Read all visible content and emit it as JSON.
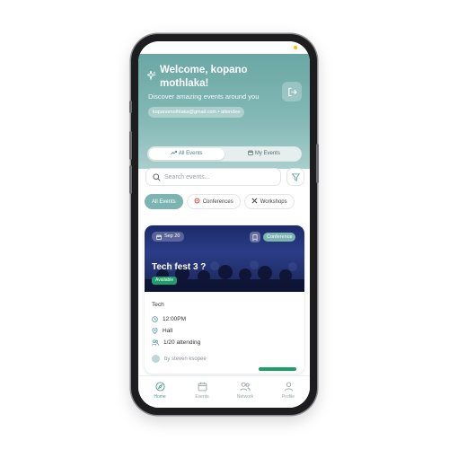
{
  "header": {
    "welcome": "Welcome, kopano mothlaka!",
    "subtitle": "Discover amazing events around you",
    "user_chip": "kopanomothlaka@gmail.com • attendee"
  },
  "tabs": [
    {
      "label": "All Events",
      "active": true
    },
    {
      "label": "My Events",
      "active": false
    }
  ],
  "search": {
    "placeholder": "Search events..."
  },
  "categories": [
    {
      "label": "All Events",
      "active": true
    },
    {
      "label": "Conferences",
      "active": false
    },
    {
      "label": "Workshops",
      "active": false
    }
  ],
  "event": {
    "date": "Sep 20",
    "type": "Conference",
    "title": "Tech fest 3 ?",
    "status": "Available",
    "category": "Tech",
    "time": "12:00PM",
    "location": "Hall",
    "attending": "1/20 attending",
    "organizer": "by steven ksopee"
  },
  "bottom_nav": [
    {
      "label": "Home",
      "icon": "compass-icon",
      "active": true
    },
    {
      "label": "Events",
      "icon": "calendar-icon",
      "active": false
    },
    {
      "label": "Network",
      "icon": "users-icon",
      "active": false
    },
    {
      "label": "Profile",
      "icon": "user-icon",
      "active": false
    }
  ],
  "colors": {
    "accent": "#7bb4b0",
    "hero_top": "#6aa7a4",
    "available": "#1f9d6a",
    "card_image": "#1b2a6b"
  }
}
